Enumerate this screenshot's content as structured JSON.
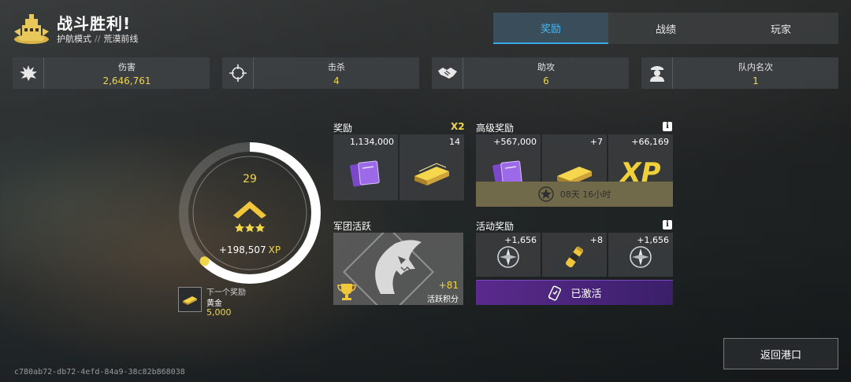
{
  "header": {
    "title": "战斗胜利!",
    "mode": "护航模式",
    "separator": "//",
    "map": "荒漠前线"
  },
  "tabs": [
    {
      "label": "奖励",
      "active": true
    },
    {
      "label": "战绩",
      "active": false
    },
    {
      "label": "玩家",
      "active": false
    }
  ],
  "stats": [
    {
      "icon": "explosion-icon",
      "label": "伤害",
      "value": "2,646,761"
    },
    {
      "icon": "crosshair-icon",
      "label": "击杀",
      "value": "4"
    },
    {
      "icon": "handshake-icon",
      "label": "助攻",
      "value": "6"
    },
    {
      "icon": "captain-icon",
      "label": "队内名次",
      "value": "1"
    }
  ],
  "progress": {
    "level": "29",
    "xp_value": "+198,507",
    "xp_unit": "XP",
    "fill_fraction": 0.62,
    "rank_stars": 3
  },
  "next_reward": {
    "label": "下一个奖励",
    "name": "黄金",
    "value": "5,000"
  },
  "rewards": {
    "title": "奖励",
    "multiplier": "X2",
    "items": [
      {
        "icon": "purple-card-icon",
        "qty": "1,134,000"
      },
      {
        "icon": "gold-bar-icon",
        "qty": "14"
      }
    ]
  },
  "premium_rewards": {
    "title": "高级奖励",
    "items": [
      {
        "icon": "purple-card-icon",
        "qty": "+567,000"
      },
      {
        "icon": "gold-bar-icon",
        "qty": "+7"
      },
      {
        "icon": "xp-icon",
        "qty": "+66,169",
        "art_text": "XP"
      }
    ],
    "timer": "08天 16小时"
  },
  "legion": {
    "title": "军团活跃",
    "points": "+81",
    "points_label": "活跃积分"
  },
  "event_rewards": {
    "title": "活动奖励",
    "items": [
      {
        "icon": "compass-token-icon",
        "qty": "+1,656"
      },
      {
        "icon": "booster-canister-icon",
        "qty": "+8"
      },
      {
        "icon": "compass-token-icon",
        "qty": "+1,656"
      }
    ],
    "status": "已激活"
  },
  "buttons": {
    "return": "返回港口"
  },
  "session_id": "c780ab72-db72-4efd-84a9-38c82b868038",
  "colors": {
    "accent_gold": "#f0d64a",
    "tab_active": "#48b8f0",
    "activated_purple": "#5a2a8c"
  }
}
